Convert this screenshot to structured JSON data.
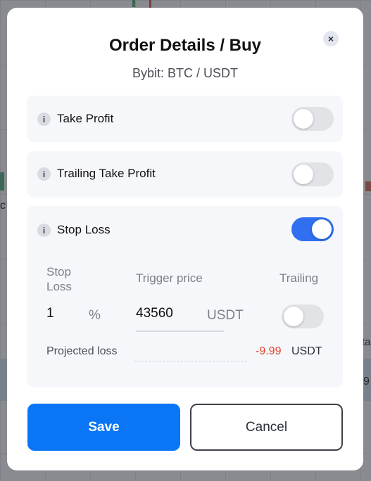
{
  "background": {
    "text_c": "c",
    "text_ta": "ta",
    "text_9": "9"
  },
  "modal": {
    "title": "Order Details / Buy",
    "close_label": "×",
    "subtitle": "Bybit: BTC / USDT",
    "info_glyph": "i",
    "sections": {
      "take_profit": {
        "label": "Take Profit",
        "enabled": false
      },
      "trailing_take_profit": {
        "label": "Trailing Take Profit",
        "enabled": false
      },
      "stop_loss": {
        "label": "Stop Loss",
        "enabled": true,
        "col_stop_loss": "Stop\nLoss",
        "col_trigger_price": "Trigger price",
        "col_trailing": "Trailing",
        "stop_loss_value": "1",
        "stop_loss_unit": "%",
        "trigger_price_value": "43560",
        "trigger_price_unit": "USDT",
        "trailing_enabled": false,
        "projected_loss_label": "Projected loss",
        "projected_loss_value": "-9.99",
        "projected_loss_unit": "USDT"
      }
    },
    "buttons": {
      "save": "Save",
      "cancel": "Cancel"
    },
    "colors": {
      "accent": "#0a76f5",
      "toggle_on": "#2f6ff0",
      "loss": "#e0452b"
    }
  }
}
